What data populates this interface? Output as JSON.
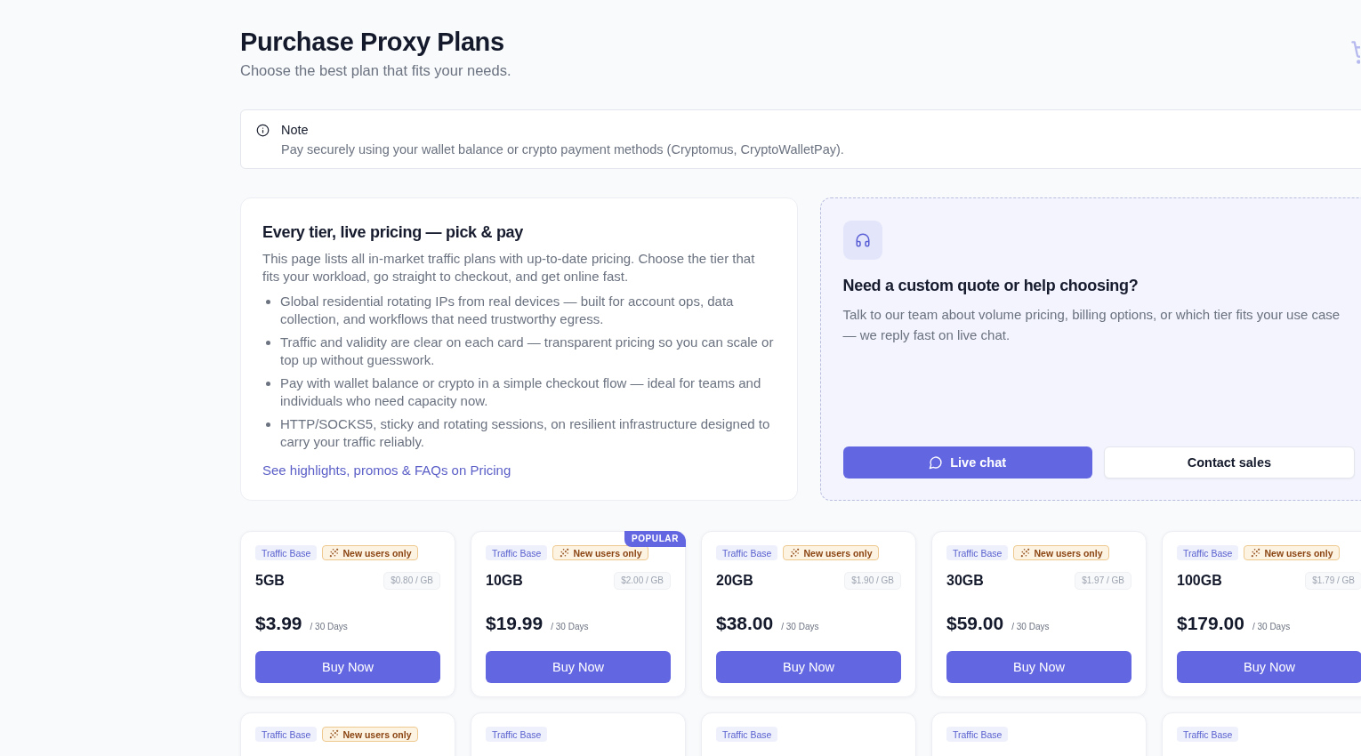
{
  "header": {
    "title": "Purchase Proxy Plans",
    "subtitle": "Choose the best plan that fits your needs."
  },
  "note": {
    "title": "Note",
    "text": "Pay securely using your wallet balance or crypto payment methods (Cryptomus, CryptoWalletPay)."
  },
  "intro": {
    "title": "Every tier, live pricing — pick & pay",
    "text": "This page lists all in-market traffic plans with up-to-date pricing. Choose the tier that fits your workload, go straight to checkout, and get online fast.",
    "bullets": [
      "Global residential rotating IPs from real devices — built for account ops, data collection, and workflows that need trustworthy egress.",
      "Traffic and validity are clear on each card — transparent pricing so you can scale or top up without guesswork.",
      "Pay with wallet balance or crypto in a simple checkout flow — ideal for teams and individuals who need capacity now.",
      "HTTP/SOCKS5, sticky and rotating sessions, on resilient infrastructure designed to carry your traffic reliably."
    ],
    "link": "See highlights, promos & FAQs on Pricing"
  },
  "support": {
    "title": "Need a custom quote or help choosing?",
    "text": "Talk to our team about volume pricing, billing options, or which tier fits your use case — we reply fast on live chat.",
    "buttons": [
      {
        "label": "Live chat",
        "kind": "chat"
      },
      {
        "label": "Contact sales",
        "kind": "sales"
      }
    ]
  },
  "plans": [
    {
      "tags": [
        {
          "label": "Traffic Base",
          "kind": "category"
        },
        {
          "label": "New users only",
          "kind": "promo"
        }
      ],
      "size": "5GB",
      "unit_price": "$0.80 / GB",
      "price": "$3.99",
      "period": "/ 30 Days",
      "button": "Buy Now"
    },
    {
      "badge": "POPULAR",
      "tags": [
        {
          "label": "Traffic Base",
          "kind": "category"
        },
        {
          "label": "New users only",
          "kind": "promo"
        }
      ],
      "size": "10GB",
      "unit_price": "$2.00 / GB",
      "price": "$19.99",
      "period": "/ 30 Days",
      "button": "Buy Now"
    },
    {
      "tags": [
        {
          "label": "Traffic Base",
          "kind": "category"
        },
        {
          "label": "New users only",
          "kind": "promo"
        }
      ],
      "size": "20GB",
      "unit_price": "$1.90 / GB",
      "price": "$38.00",
      "period": "/ 30 Days",
      "button": "Buy Now"
    },
    {
      "tags": [
        {
          "label": "Traffic Base",
          "kind": "category"
        },
        {
          "label": "New users only",
          "kind": "promo"
        }
      ],
      "size": "30GB",
      "unit_price": "$1.97 / GB",
      "price": "$59.00",
      "period": "/ 30 Days",
      "button": "Buy Now"
    },
    {
      "tags": [
        {
          "label": "Traffic Base",
          "kind": "category"
        },
        {
          "label": "New users only",
          "kind": "promo"
        }
      ],
      "size": "100GB",
      "unit_price": "$1.79 / GB",
      "price": "$179.00",
      "period": "/ 30 Days",
      "button": "Buy Now"
    },
    {
      "tags": [
        {
          "label": "Traffic Base",
          "kind": "category"
        },
        {
          "label": "New users only",
          "kind": "promo"
        }
      ]
    },
    {
      "tags": [
        {
          "label": "Traffic Base",
          "kind": "category"
        }
      ]
    },
    {
      "tags": [
        {
          "label": "Traffic Base",
          "kind": "category"
        }
      ]
    },
    {
      "tags": [
        {
          "label": "Traffic Base",
          "kind": "category"
        }
      ]
    },
    {
      "tags": [
        {
          "label": "Traffic Base",
          "kind": "category"
        }
      ]
    }
  ]
}
